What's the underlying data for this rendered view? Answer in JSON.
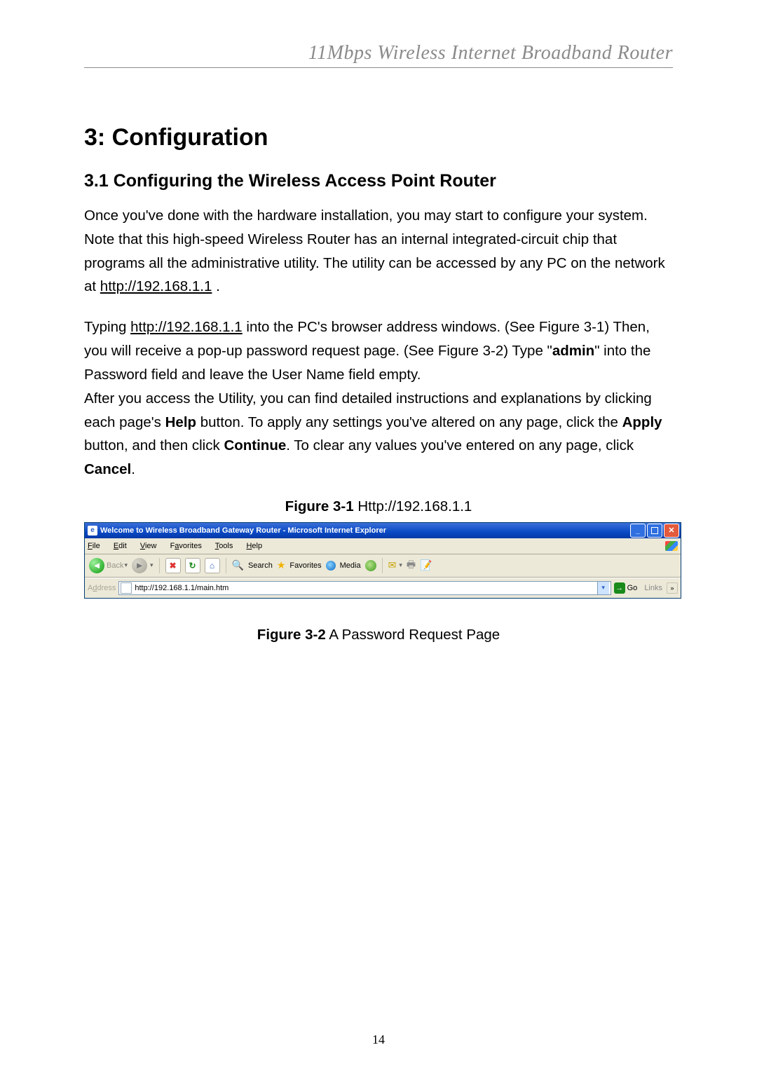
{
  "doc": {
    "header": "11Mbps  Wireless  Internet  Broadband  Router",
    "h1": "3: Configuration",
    "h2": "3.1 Configuring the Wireless Access Point Router",
    "p1_a": "Once you've done with the hardware installation, you may start to configure your system. Note that this high-speed Wireless Router has an internal integrated-circuit chip that programs all the administrative utility. The utility can be accessed by any PC on the network at ",
    "p1_link": "http://192.168.1.1",
    "p1_b": " .",
    "p2_a": "Typing ",
    "p2_link": "http://192.168.1.1",
    "p2_b": " into the PC's browser address windows. (See Figure 3-1) Then, you will receive a pop-up password request page. (See Figure 3-2) Type \"",
    "p2_admin": "admin",
    "p2_c": "\" into the Password field and leave the User Name field empty.",
    "p3_a": "After you access the Utility, you can find detailed instructions and explanations by clicking each page's ",
    "p3_help": "Help",
    "p3_b": " button. To apply any settings you've altered on any page, click the ",
    "p3_apply": "Apply",
    "p3_c": " button, and then click ",
    "p3_continue": "Continue",
    "p3_d": ". To clear any values you've entered on any page, click ",
    "p3_cancel": "Cancel",
    "p3_e": ".",
    "fig1_label": "Figure 3-1",
    "fig1_text": " Http://192.168.1.1",
    "fig2_label": "Figure 3-2",
    "fig2_text": " A Password Request Page",
    "page_number": "14"
  },
  "ie": {
    "title": "Welcome to Wireless Broadband Gateway Router - Microsoft Internet Explorer",
    "menu": {
      "file": "File",
      "edit": "Edit",
      "view": "View",
      "favorites": "Favorites",
      "tools": "Tools",
      "help": "Help"
    },
    "toolbar": {
      "back": "Back",
      "search": "Search",
      "favorites": "Favorites",
      "media": "Media"
    },
    "address_label": "Address",
    "address_value": "http://192.168.1.1/main.htm",
    "go": "Go",
    "links": "Links"
  }
}
